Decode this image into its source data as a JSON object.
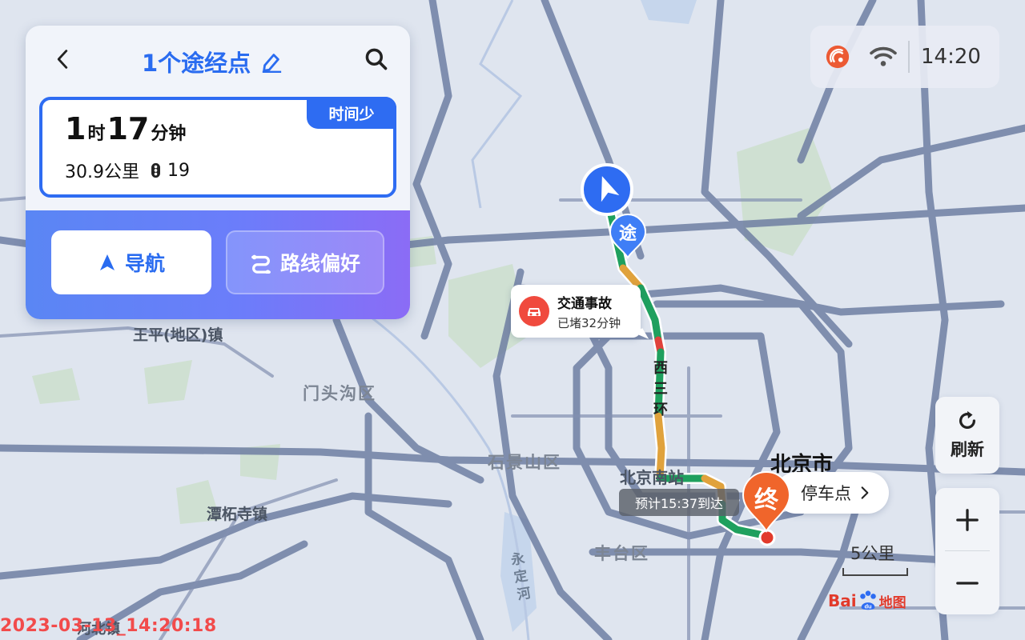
{
  "header": {
    "title": "1个途经点"
  },
  "route": {
    "tag": "时间少",
    "hours": "1",
    "hours_unit": "时",
    "minutes": "17",
    "minutes_unit": "分钟",
    "distance": "30.9公里",
    "traffic_lights": "19"
  },
  "actions": {
    "navigate_label": "导航",
    "preference_label": "路线偏好"
  },
  "status": {
    "time": "14:20"
  },
  "controls": {
    "refresh_label": "刷新"
  },
  "incident": {
    "title": "交通事故",
    "detail": "已堵32分钟"
  },
  "map": {
    "labels": {
      "wangping": "王平(地区)镇",
      "mentougou": "门头沟区",
      "shijingshan": "石景山区",
      "tanzhesi": "潭柘寺镇",
      "fengtai": "丰台区",
      "beijing_south": "北京南站",
      "beijing_city": "北京市",
      "xisanhuan": "西三环",
      "yongdinghe": "永定河",
      "hebei": "河北镇"
    },
    "eta": "预计15:37到达",
    "waypoint_char": "途",
    "end_char": "终",
    "parking_label": "停车点",
    "scale_label": "5公里",
    "brand_text": "地图"
  },
  "watermark": "2023-03-13_14:20:18"
}
